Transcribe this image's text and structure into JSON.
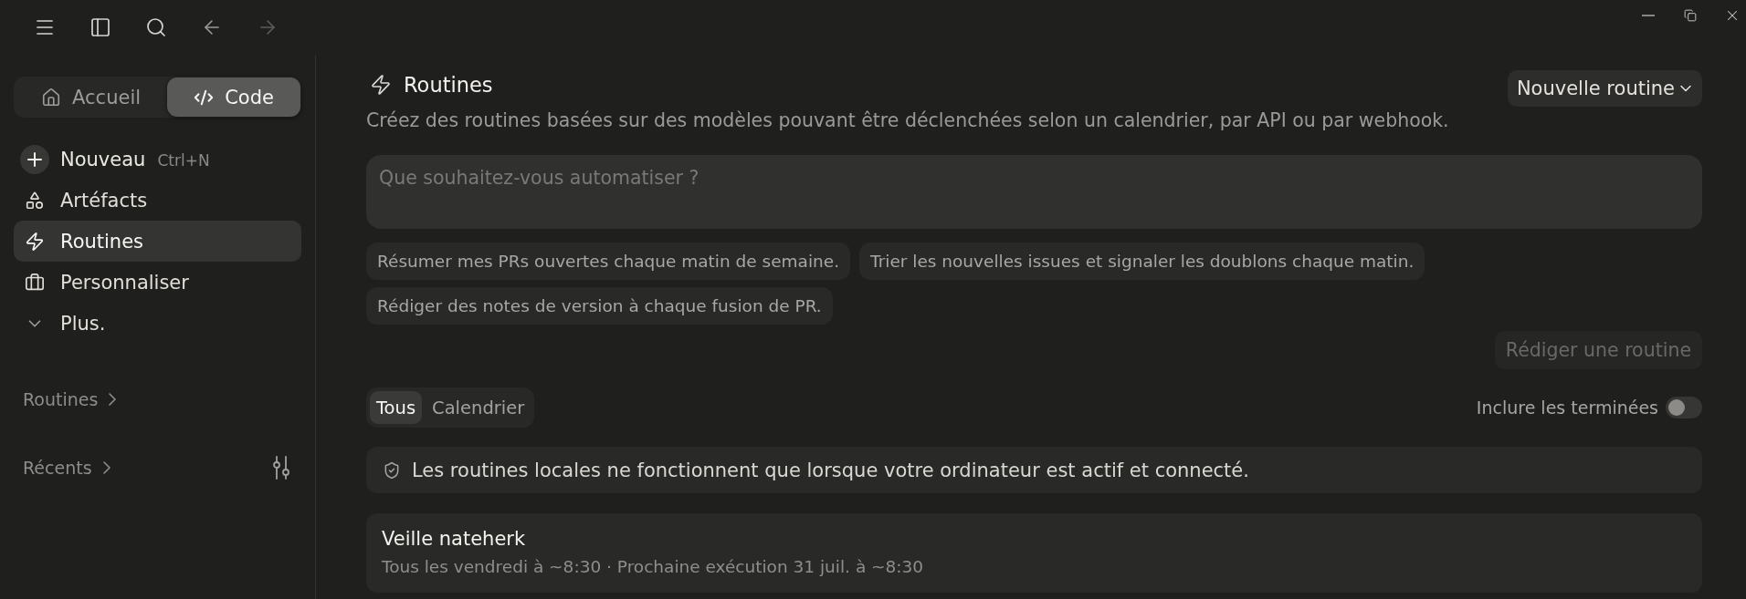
{
  "toolbar": {
    "nav": [
      {
        "kind": "back",
        "disabled": false
      },
      {
        "kind": "forward",
        "disabled": true
      }
    ]
  },
  "sidebar": {
    "modes": [
      {
        "kind": "home",
        "label": "Accueil",
        "selected": false
      },
      {
        "kind": "code",
        "label": "Code",
        "selected": true
      }
    ],
    "new_item": {
      "label": "Nouveau",
      "shortcut": "Ctrl+N"
    },
    "items": [
      {
        "kind": "artifacts",
        "label": "Artéfacts",
        "selected": false
      },
      {
        "kind": "routines",
        "label": "Routines",
        "selected": true
      },
      {
        "kind": "customize",
        "label": "Personnaliser",
        "selected": false
      },
      {
        "kind": "more",
        "label": "Plus.",
        "selected": false
      }
    ],
    "sections": [
      {
        "kind": "plain",
        "label": "Routines"
      },
      {
        "kind": "filterable",
        "label": "Récents"
      }
    ]
  },
  "main": {
    "title": "Routines",
    "new_button": "Nouvelle routine",
    "description": "Créez des routines basées sur des modèles pouvant être déclenchées selon un calendrier, par API ou par webhook.",
    "prompt": {
      "placeholder": "Que souhaitez-vous automatiser ?"
    },
    "suggestions": [
      "Résumer mes PRs ouvertes chaque matin de semaine.",
      "Trier les nouvelles issues et signaler les doublons chaque matin.",
      "Rédiger des notes de version à chaque fusion de PR."
    ],
    "compose_button": {
      "label": "Rédiger une routine",
      "disabled": true
    },
    "filters": [
      {
        "label": "Tous",
        "selected": true
      },
      {
        "label": "Calendrier",
        "selected": false
      }
    ],
    "include_finished": {
      "label": "Inclure les terminées",
      "on": false
    },
    "notice": "Les routines locales ne fonctionnent que lorsque votre ordinateur est actif et connecté.",
    "routines": [
      {
        "name": "Veille nateherk",
        "schedule": "Tous les vendredi à ~8:30 · Prochaine exécution 31 juil. à ~8:30"
      }
    ]
  }
}
